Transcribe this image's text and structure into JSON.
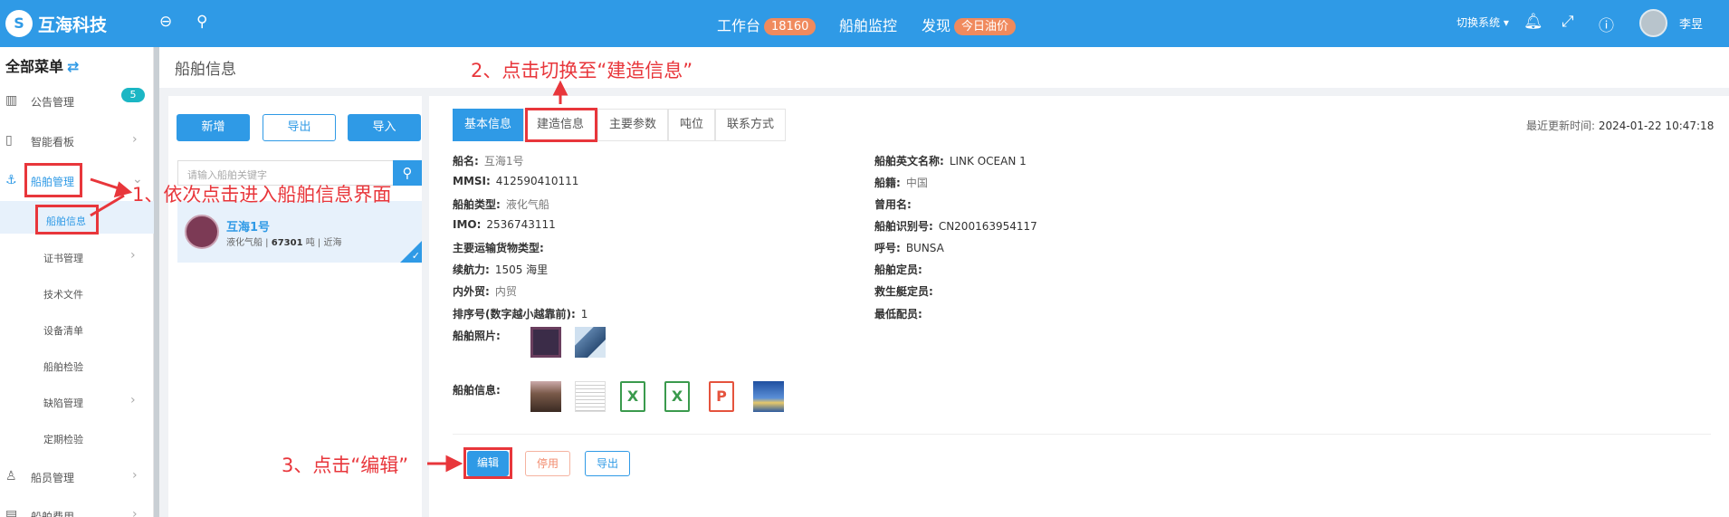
{
  "header": {
    "brand": "互海科技",
    "nav": {
      "workbench": "工作台",
      "workbench_count": "18160",
      "monitor": "船舶监控",
      "discover": "发现",
      "oil_price": "今日油价"
    },
    "switch_system": "切换系统",
    "user_name": "李昱"
  },
  "sidebar": {
    "title": "全部菜单",
    "items": [
      {
        "label": "公告管理",
        "badge": "5"
      },
      {
        "label": "智能看板"
      },
      {
        "label": "船舶管理"
      },
      {
        "label": "船员管理"
      },
      {
        "label": "船舶费用"
      }
    ],
    "subitems": [
      "船舶信息",
      "证书管理",
      "技术文件",
      "设备清单",
      "船舶检验",
      "缺陷管理",
      "定期检验"
    ]
  },
  "page": {
    "title": "船舶信息"
  },
  "list": {
    "add_label": "新增",
    "export_label": "导出",
    "import_label": "导入",
    "search_placeholder": "请输入船舶关键字",
    "ship": {
      "name": "互海1号",
      "type": "液化气船",
      "tonnage": "67301",
      "unit": "吨",
      "area": "近海"
    }
  },
  "tabs": [
    "基本信息",
    "建造信息",
    "主要参数",
    "吨位",
    "联系方式"
  ],
  "update": {
    "label": "最近更新时间:",
    "value": "2024-01-22 10:47:18"
  },
  "fields_left": [
    {
      "key": "船名:",
      "value": "互海1号"
    },
    {
      "key": "MMSI:",
      "value": "412590410111"
    },
    {
      "key": "船舶类型:",
      "value": "液化气船"
    },
    {
      "key": "IMO:",
      "value": "2536743111"
    },
    {
      "key": "主要运输货物类型:",
      "value": ""
    },
    {
      "key": "续航力:",
      "value": "1505 海里"
    },
    {
      "key": "内外贸:",
      "value": "内贸"
    },
    {
      "key": "排序号(数字越小越靠前):",
      "value": "1"
    },
    {
      "key": "船舶照片:",
      "value": ""
    },
    {
      "key": "船舶信息:",
      "value": ""
    }
  ],
  "fields_right": [
    {
      "key": "船舶英文名称:",
      "value": "LINK OCEAN 1"
    },
    {
      "key": "船籍:",
      "value": "中国"
    },
    {
      "key": "曾用名:",
      "value": ""
    },
    {
      "key": "船舶识别号:",
      "value": "CN200163954117"
    },
    {
      "key": "呼号:",
      "value": "BUNSA"
    },
    {
      "key": "船舶定员:",
      "value": ""
    },
    {
      "key": "救生艇定员:",
      "value": ""
    },
    {
      "key": "最低配员:",
      "value": ""
    }
  ],
  "actions": {
    "edit": "编辑",
    "disable": "停用",
    "export": "导出"
  },
  "annotations": {
    "step1": "1、依次点击进入船舶信息界面",
    "step2": "2、点击切换至“建造信息”",
    "step3": "3、点击“编辑”"
  },
  "colors": {
    "primary": "#2f9ae6",
    "annotation": "#e8363b",
    "badge": "#1bb6c4",
    "pill": "#f08a5d"
  }
}
